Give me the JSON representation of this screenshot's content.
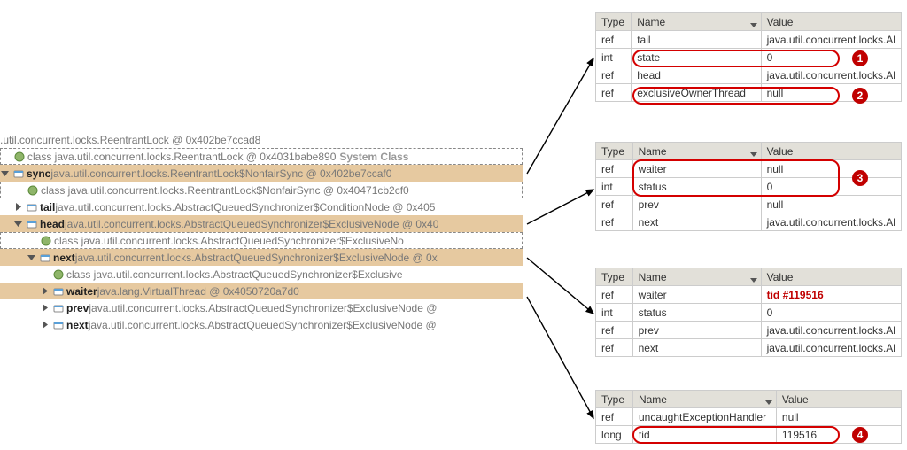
{
  "tree": {
    "root": ".util.concurrent.locks.ReentrantLock @ 0x402be7ccad8",
    "rows": [
      {
        "indent": 1,
        "dashed": true,
        "twist": "none",
        "icon": "class",
        "bold": "<class>",
        "text": " class java.util.concurrent.locks.ReentrantLock @ 0x4031babe890 ",
        "suffix": "System Class"
      },
      {
        "indent": 1,
        "hl": true,
        "twist": "open",
        "icon": "field",
        "bold": "sync",
        "text": " java.util.concurrent.locks.ReentrantLock$NonfairSync @ 0x402be7ccaf0"
      },
      {
        "indent": 2,
        "dashed": true,
        "twist": "none",
        "icon": "class",
        "bold": "<class>",
        "text": " class java.util.concurrent.locks.ReentrantLock$NonfairSync @ 0x40471cb2cf0"
      },
      {
        "indent": 2,
        "twist": "closed",
        "icon": "field",
        "bold": "tail",
        "text": " java.util.concurrent.locks.AbstractQueuedSynchronizer$ConditionNode @ 0x405"
      },
      {
        "indent": 2,
        "hl": true,
        "twist": "open",
        "icon": "field",
        "bold": "head",
        "text": " java.util.concurrent.locks.AbstractQueuedSynchronizer$ExclusiveNode @ 0x40"
      },
      {
        "indent": 3,
        "dashed": true,
        "twist": "none",
        "icon": "class",
        "bold": "<class>",
        "text": " class java.util.concurrent.locks.AbstractQueuedSynchronizer$ExclusiveNo"
      },
      {
        "indent": 3,
        "hl": true,
        "twist": "open",
        "icon": "field",
        "bold": "next",
        "text": " java.util.concurrent.locks.AbstractQueuedSynchronizer$ExclusiveNode @ 0x"
      },
      {
        "indent": 4,
        "twist": "none",
        "icon": "class",
        "bold": "<class>",
        "text": " class java.util.concurrent.locks.AbstractQueuedSynchronizer$Exclusive"
      },
      {
        "indent": 4,
        "hl": true,
        "twist": "closed",
        "icon": "field",
        "bold": "waiter",
        "text": " java.lang.VirtualThread @ 0x4050720a7d0"
      },
      {
        "indent": 4,
        "twist": "closed",
        "icon": "field",
        "bold": "prev",
        "text": " java.util.concurrent.locks.AbstractQueuedSynchronizer$ExclusiveNode @"
      },
      {
        "indent": 4,
        "twist": "closed",
        "icon": "field",
        "bold": "next",
        "text": " java.util.concurrent.locks.AbstractQueuedSynchronizer$ExclusiveNode @"
      }
    ]
  },
  "tables": {
    "headers": {
      "type": "Type",
      "name": "Name",
      "value": "Value"
    },
    "t1": [
      {
        "type": "ref",
        "name": "tail",
        "value": "java.util.concurrent.locks.Al"
      },
      {
        "type": "int",
        "name": "state",
        "value": "0"
      },
      {
        "type": "ref",
        "name": "head",
        "value": "java.util.concurrent.locks.Al"
      },
      {
        "type": "ref",
        "name": "exclusiveOwnerThread",
        "value": "null"
      }
    ],
    "t2": [
      {
        "type": "ref",
        "name": "waiter",
        "value": "null"
      },
      {
        "type": "int",
        "name": "status",
        "value": "0"
      },
      {
        "type": "ref",
        "name": "prev",
        "value": "null"
      },
      {
        "type": "ref",
        "name": "next",
        "value": "java.util.concurrent.locks.Al"
      }
    ],
    "t3": [
      {
        "type": "ref",
        "name": "waiter",
        "value": "tid #119516",
        "tid": true
      },
      {
        "type": "int",
        "name": "status",
        "value": "0"
      },
      {
        "type": "ref",
        "name": "prev",
        "value": "java.util.concurrent.locks.Al"
      },
      {
        "type": "ref",
        "name": "next",
        "value": "java.util.concurrent.locks.Al"
      }
    ],
    "t4": [
      {
        "type": "ref",
        "name": "uncaughtExceptionHandler",
        "value": "null"
      },
      {
        "type": "long",
        "name": "tid",
        "value": "119516"
      }
    ]
  },
  "badges": {
    "b1": "1",
    "b2": "2",
    "b3": "3",
    "b4": "4"
  }
}
